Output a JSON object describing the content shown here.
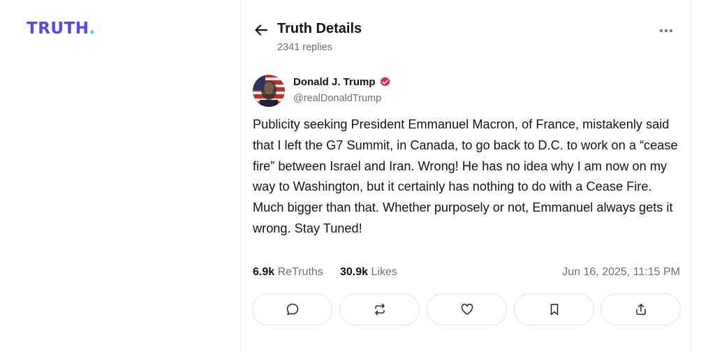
{
  "brand": {
    "logo_text": "TRUTH",
    "logo_dot": ".",
    "colors": {
      "primary": "#5448ee",
      "accent": "#17e2c5"
    }
  },
  "header": {
    "back_icon": "arrow-left-icon",
    "title": "Truth Details",
    "replies": "2341 replies",
    "more_icon": "more-horizontal-icon"
  },
  "post": {
    "author": {
      "name": "Donald J. Trump",
      "handle": "@realDonaldTrump",
      "verified_icon": "verified-badge-icon",
      "verified_color": "#e0245e"
    },
    "text": "Publicity seeking President Emmanuel Macron, of France, mistakenly said that I left the G7 Summit, in Canada, to go back to D.C. to work on a “cease fire” between Israel and Iran. Wrong! He has no idea why I am now on my way to Washington, but it certainly has nothing to do with a Cease Fire. Much bigger than that. Whether purposely or not, Emmanuel always gets it wrong. Stay Tuned!",
    "stats": {
      "retruths_count": "6.9k",
      "retruths_label": "ReTruths",
      "likes_count": "30.9k",
      "likes_label": "Likes"
    },
    "timestamp": "Jun 16, 2025, 11:15 PM"
  },
  "actions": [
    {
      "icon": "reply-icon"
    },
    {
      "icon": "retruth-icon"
    },
    {
      "icon": "like-icon"
    },
    {
      "icon": "bookmark-icon"
    },
    {
      "icon": "share-icon"
    }
  ]
}
